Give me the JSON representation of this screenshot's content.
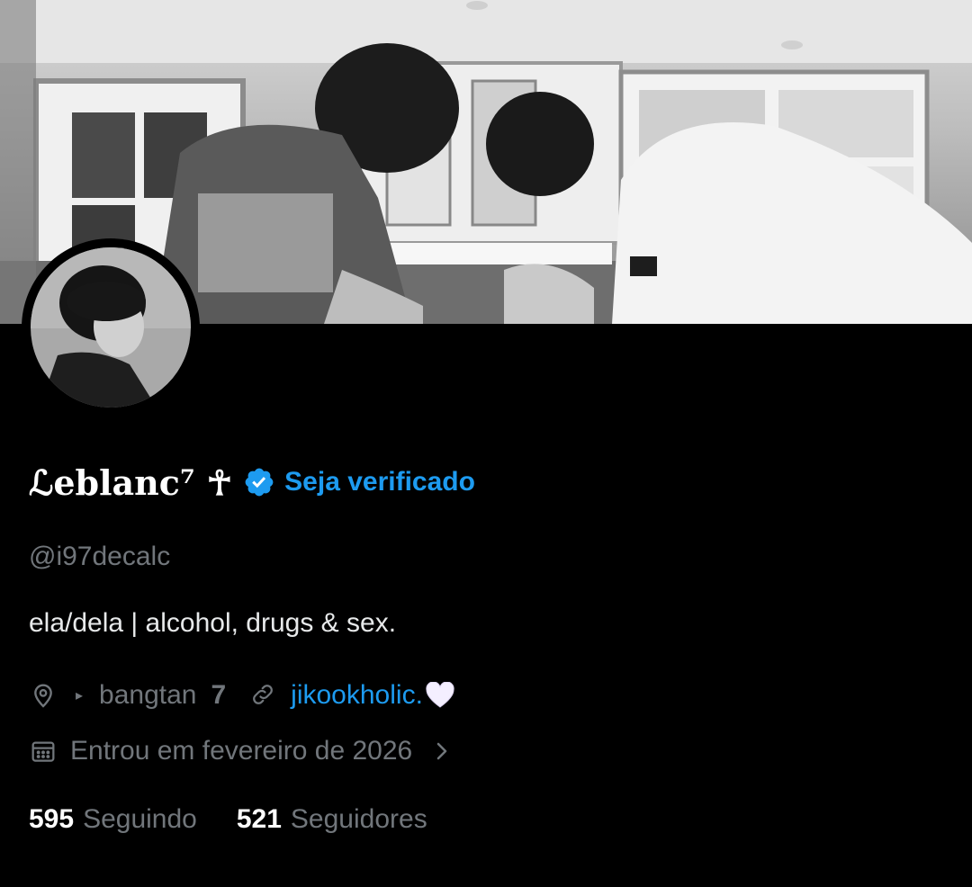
{
  "profile": {
    "display_name": "ℒeblanc⁷ ☥",
    "get_verified_label": "Seja verificado",
    "handle": "@i97decalc",
    "bio": "ela/dela | alcohol, drugs & sex.",
    "location_arrow": "▸",
    "location": "bangtan",
    "location_suffix": "7",
    "website": "jikookholic.",
    "joined": "Entrou em fevereiro de 2026",
    "following_count": "595",
    "following_label": "Seguindo",
    "followers_count": "521",
    "followers_label": "Seguidores"
  },
  "icons": {
    "verified": "verified-badge-icon",
    "location": "map-pin-icon",
    "link": "link-icon",
    "heart": "white-heart-icon",
    "calendar": "calendar-icon",
    "chevron": "chevron-right-icon"
  },
  "colors": {
    "background": "#000000",
    "accent": "#1d9bf0",
    "primary_text": "#e7e9ea",
    "secondary_text": "#71767b"
  }
}
